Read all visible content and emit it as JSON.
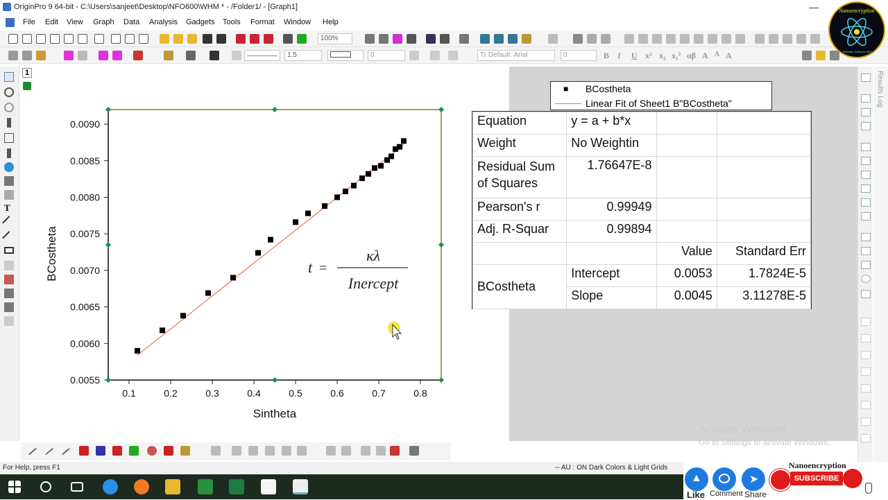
{
  "window": {
    "title": "OriginPro 9 64-bit - C:\\Users\\sanjeet\\Desktop\\NFO600\\WHM * - /Folder1/ - [Graph1]",
    "minimize_glyph": "—"
  },
  "menu": [
    "File",
    "Edit",
    "View",
    "Graph",
    "Data",
    "Analysis",
    "Gadgets",
    "Tools",
    "Format",
    "Window",
    "Help"
  ],
  "toolbar": {
    "zoom": "100%",
    "line_width": "1.5",
    "font": "Tr Default: Arial",
    "font_size": "0",
    "angle": "0",
    "text_buttons": [
      "B",
      "I",
      "U",
      "x²",
      "x₂",
      "x₁²",
      "αβ",
      "A",
      "A",
      "A"
    ]
  },
  "page_number": "1",
  "graph": {
    "xlabel": "Sintheta",
    "ylabel": "BCostheta",
    "formula": {
      "lhs": "t",
      "eq": "=",
      "numerator": "κλ",
      "denominator": "Inercept"
    }
  },
  "chart_data": {
    "type": "scatter",
    "title": "",
    "xlabel": "Sintheta",
    "ylabel": "BCostheta",
    "xlim": [
      0.05,
      0.85
    ],
    "ylim": [
      0.0055,
      0.0092
    ],
    "x_ticks": [
      "0.1",
      "0.2",
      "0.3",
      "0.4",
      "0.5",
      "0.6",
      "0.7",
      "0.8"
    ],
    "y_ticks": [
      "0.0055",
      "0.0060",
      "0.0065",
      "0.0070",
      "0.0075",
      "0.0080",
      "0.0085",
      "0.0090"
    ],
    "x_tick_values": [
      0.1,
      0.2,
      0.3,
      0.4,
      0.5,
      0.6,
      0.7,
      0.8
    ],
    "y_tick_values": [
      0.0055,
      0.006,
      0.0065,
      0.007,
      0.0075,
      0.008,
      0.0085,
      0.009
    ],
    "grid": false,
    "legend_position": "top-right",
    "series": [
      {
        "name": "BCostheta",
        "marker": "square",
        "color": "#000000",
        "x": [
          0.12,
          0.18,
          0.23,
          0.29,
          0.35,
          0.41,
          0.44,
          0.5,
          0.53,
          0.57,
          0.6,
          0.62,
          0.64,
          0.66,
          0.675,
          0.69,
          0.705,
          0.72,
          0.73,
          0.74,
          0.75,
          0.76
        ],
        "y": [
          0.0059,
          0.00618,
          0.00638,
          0.00669,
          0.0069,
          0.00724,
          0.00742,
          0.00766,
          0.00778,
          0.00788,
          0.008,
          0.00808,
          0.00816,
          0.00826,
          0.00832,
          0.0084,
          0.00843,
          0.00851,
          0.00856,
          0.00866,
          0.00869,
          0.00877
        ]
      },
      {
        "name": "Linear Fit of Sheet1 B\"BCostheta\"",
        "type": "line",
        "color": "#e8735a",
        "x": [
          0.12,
          0.76
        ],
        "y": [
          0.00584,
          0.00872
        ]
      }
    ]
  },
  "legend": {
    "items": [
      {
        "label": "BCostheta",
        "symbol": "■"
      },
      {
        "label": "Linear Fit of Sheet1 B\"BCostheta\"",
        "symbol": "line"
      }
    ]
  },
  "fit_table": {
    "equation_label": "Equation",
    "equation_value": "y = a + b*x",
    "weight_label": "Weight",
    "weight_value": "No Weightin",
    "rss_label": "Residual Sum of Squares",
    "rss_value": "1.76647E-8",
    "pearson_label": "Pearson's r",
    "pearson_value": "0.99949",
    "adjr_label": "Adj. R-Squar",
    "adjr_value": "0.99894",
    "value_header": "Value",
    "stderr_header": "Standard Err",
    "group_label": "BCostheta",
    "intercept_label": "Intercept",
    "intercept_value": "0.0053",
    "intercept_err": "1.7824E-5",
    "slope_label": "Slope",
    "slope_value": "0.0045",
    "slope_err": "3.11278E-5"
  },
  "status": {
    "help": "For Help, press F1",
    "right": "-- AU : ON  Dark Colors & Light Grids"
  },
  "watermark": {
    "line1": "Activate Windows",
    "line2": "Go to Settings to activate Windows."
  },
  "social": {
    "brand": "Nanoencryption",
    "like": "Like",
    "comment": "Comment",
    "share": "Share",
    "subscribe": "SUBSCRIBE"
  },
  "logo": {
    "text": "Nanoencryption",
    "subtext": "Scientific Software Skill"
  },
  "colors": {
    "plot_frame": "#8a7a1e",
    "handle": "#1e8a5a",
    "fit_line": "#e8735a",
    "accent_blue": "#1f7ae0",
    "subscribe_red": "#e01b1b"
  }
}
